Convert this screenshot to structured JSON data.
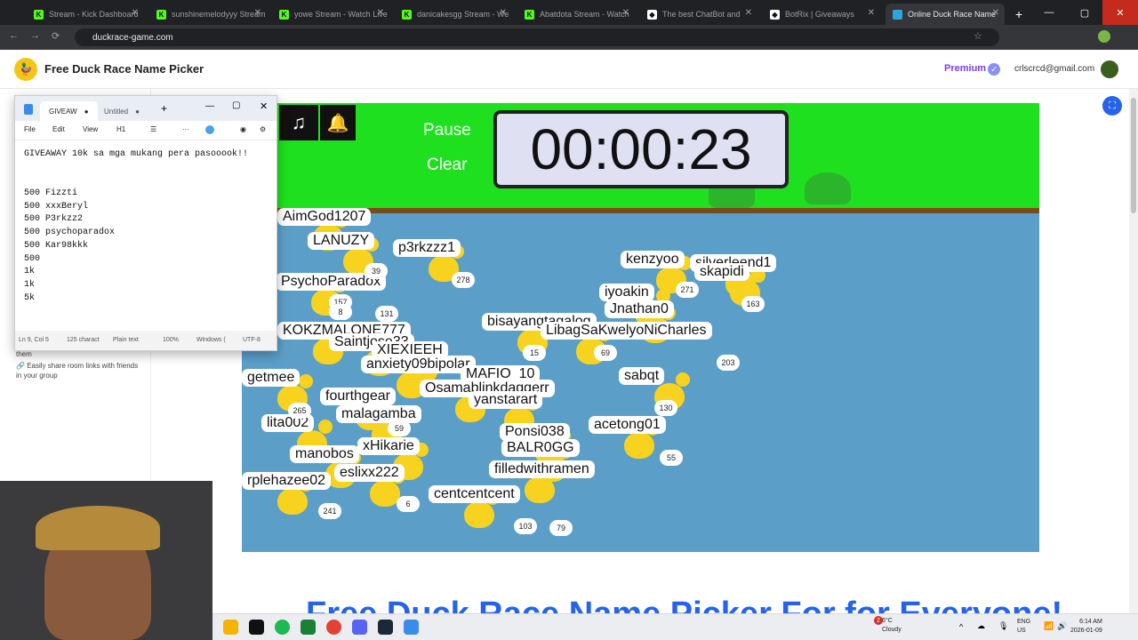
{
  "browser": {
    "tabs": [
      {
        "label": "Stream - Kick Dashboard",
        "icon": "kick-icon",
        "color": "#53fc18"
      },
      {
        "label": "sunshinemelodyyy Stream",
        "icon": "kick-icon",
        "color": "#53fc18"
      },
      {
        "label": "yowe Stream - Watch Live",
        "icon": "kick-icon",
        "color": "#53fc18"
      },
      {
        "label": "danicakesgg Stream - We",
        "icon": "kick-icon",
        "color": "#53fc18"
      },
      {
        "label": "Abatdota Stream - Watch",
        "icon": "kick-icon",
        "color": "#53fc18"
      },
      {
        "label": "The best ChatBot and",
        "icon": "diamond-icon",
        "color": "#ffffff"
      },
      {
        "label": "BotRix | Giveaways",
        "icon": "diamond-icon",
        "color": "#ffffff"
      },
      {
        "label": "Online Duck Race Name",
        "icon": "duck-icon",
        "color": "#2aa7e0"
      }
    ],
    "url": "duckrace-game.com"
  },
  "app": {
    "title": "Free Duck Race Name Picker",
    "premium": "Premium",
    "user_email": "crlscrcd@gmail.com",
    "tips": [
      "them",
      "Easily share room links with friends in your group"
    ],
    "bottom_title": "Free Duck Race Name Picker For for Everyone!"
  },
  "race": {
    "timer": "00:00:23",
    "pause_label": "Pause",
    "clear_label": "Clear",
    "colors": {
      "grass": "#1ee01e",
      "water": "#5b9fc9",
      "bank": "#7a4a1a"
    },
    "ducks": [
      {
        "name": "AimGod1207"
      },
      {
        "name": "LANUZY"
      },
      {
        "name": "p3rkzzz1"
      },
      {
        "name": "PsychoParadox"
      },
      {
        "name": "KOKZMALONE777"
      },
      {
        "name": "Saintjose33"
      },
      {
        "name": "kenzyoo"
      },
      {
        "name": "silverleend1"
      },
      {
        "name": "skapidi"
      },
      {
        "name": "iyoakin"
      },
      {
        "name": "Jnathan0"
      },
      {
        "name": "bisayangtagalog"
      },
      {
        "name": "LibagSaKwelyoNiCharles"
      },
      {
        "name": "XIEXIEEH"
      },
      {
        "name": "anxiety09bipolar"
      },
      {
        "name": "MAFIO_10"
      },
      {
        "name": "getmee"
      },
      {
        "name": "Osamablinkdaggerr"
      },
      {
        "name": "sabqt"
      },
      {
        "name": "fourthgear"
      },
      {
        "name": "yanstarart"
      },
      {
        "name": "malagamba"
      },
      {
        "name": "lita002"
      },
      {
        "name": "acetong01"
      },
      {
        "name": "Ponsi038"
      },
      {
        "name": "BALR0GG"
      },
      {
        "name": "xHikarie"
      },
      {
        "name": "manobos"
      },
      {
        "name": "eslixx222"
      },
      {
        "name": "filledwithramen"
      },
      {
        "name": "rplehazee02"
      },
      {
        "name": "centcentcent"
      }
    ],
    "numbers": [
      "278",
      "39",
      "157",
      "8",
      "131",
      "271",
      "163",
      "203",
      "69",
      "130",
      "265",
      "59",
      "55",
      "241",
      "6",
      "103",
      "79",
      "15"
    ]
  },
  "notepad": {
    "tab1": "GIVEAW",
    "tab2": "Untitled",
    "menu": {
      "file": "File",
      "edit": "Edit",
      "view": "View",
      "heading": "H1"
    },
    "lines": [
      "GIVEAWAY 10k sa mga mukang pera pasooook!!",
      "",
      "",
      "500 Fizzti",
      "500 xxxBeryl",
      "500 P3rkzz2",
      "500 psychoparadox",
      "500 Kar98kkk",
      "500",
      "1k",
      "1k",
      "5k"
    ],
    "status": {
      "position": "Ln 9, Col 5",
      "chars": "125 charact",
      "format": "Plain text",
      "zoom": "100%",
      "eol": "Windows (",
      "encoding": "UTF-8"
    }
  },
  "taskbar": {
    "weather_temp": "6°C",
    "weather_desc": "Cloudy",
    "notif_count": "2",
    "lang": "ENG",
    "region": "US",
    "time": "6:14 AM",
    "date": "2026-01-09"
  }
}
